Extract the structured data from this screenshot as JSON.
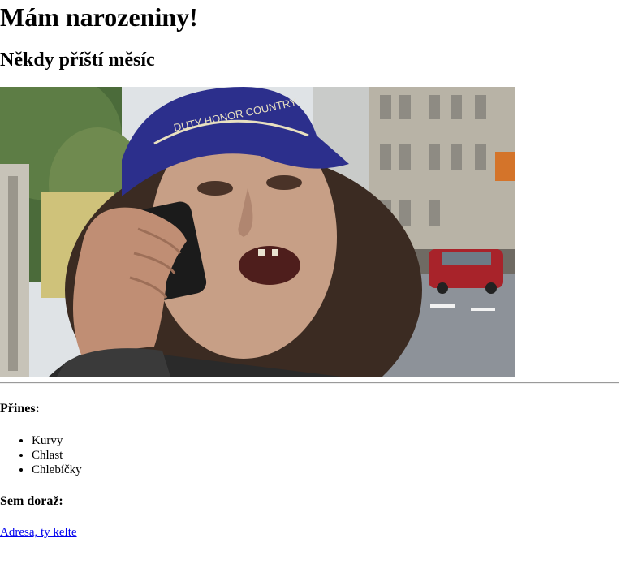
{
  "title": "Mám narozeniny!",
  "subtitle": "Někdy příští měsíc",
  "photo": {
    "alt": "Muž s kšiltovkou telefonuje na ulici",
    "cap_text": "DUTY HONOR COUNTRY",
    "colors": {
      "cap": "#2c2f8c",
      "sky": "#dfe3e6",
      "building": "#b8b3a6",
      "street": "#8d9299",
      "car": "#a8232a"
    }
  },
  "bring": {
    "heading": "Přines:",
    "items": [
      "Kurvy",
      "Chlast",
      "Chlebíčky"
    ]
  },
  "where": {
    "heading": "Sem doraž:",
    "link_text": "Adresa, ty kelte",
    "link_color": "#0000ee"
  }
}
